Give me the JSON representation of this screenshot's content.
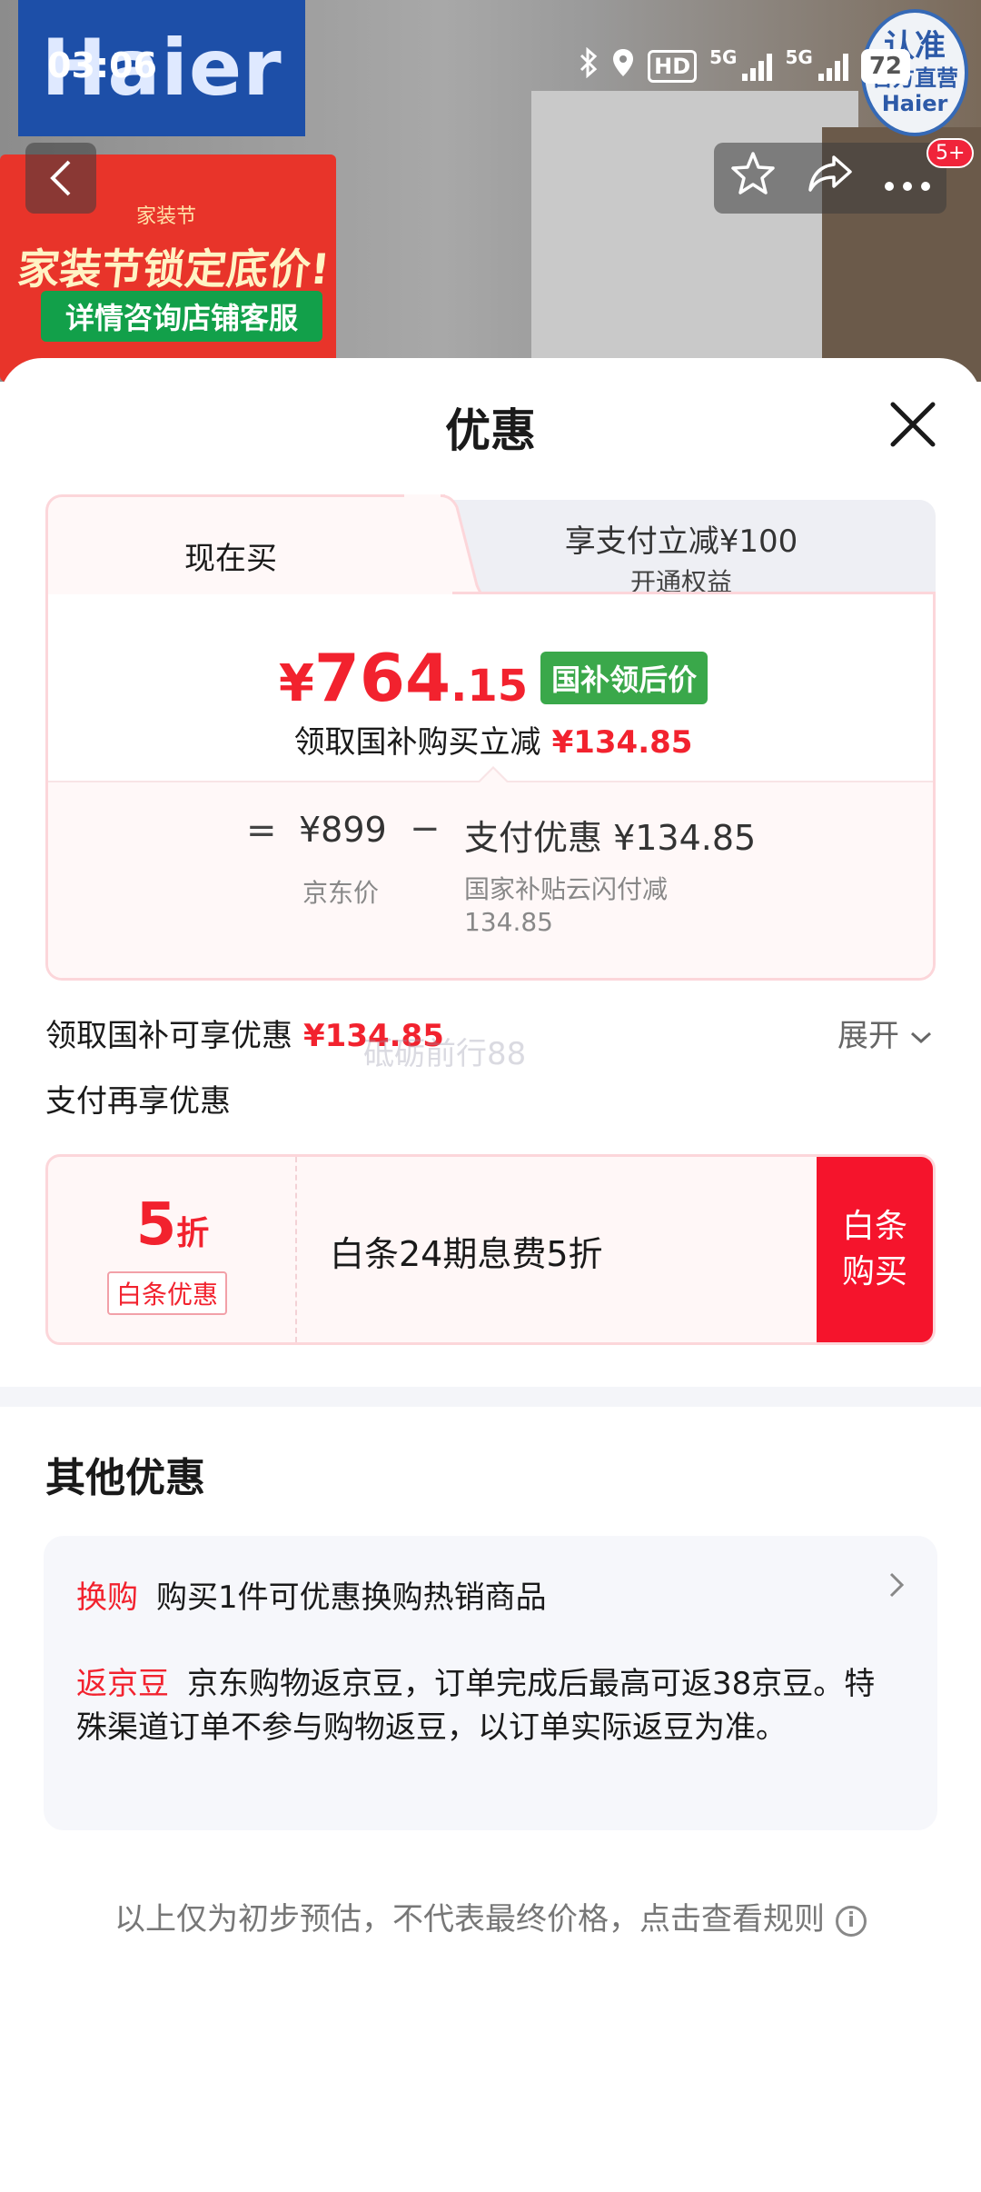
{
  "status_bar": {
    "time": "03:06",
    "hd_label": "HD",
    "net1": "5G",
    "net2": "5G",
    "battery": "72"
  },
  "background": {
    "brand_logo": "Haier",
    "badge_line1": "认准",
    "badge_line2": "官方直营",
    "badge_line3": "Haier",
    "promo_top": "家装节",
    "promo_main": "家装节锁定底价!",
    "promo_sub": "详情咨询店铺客服"
  },
  "nav": {
    "cart_badge": "5+"
  },
  "sheet": {
    "title": "优惠"
  },
  "tabs": {
    "active_label": "现在买",
    "inactive_line1": "享支付立减¥100",
    "inactive_line2": "开通权益"
  },
  "price": {
    "yen": "¥",
    "integer": "764",
    "decimal": ".15",
    "tag": "国补领后价",
    "subsidy_text": "领取国补购买立减",
    "subsidy_amount": "¥134.85"
  },
  "calc": {
    "equals": "=",
    "jd_price": "¥899",
    "jd_label": "京东价",
    "minus": "−",
    "pay_discount": "支付优惠 ¥134.85",
    "pay_desc_line1": "国家补贴云闪付减",
    "pay_desc_line2": "134.85"
  },
  "gov_row": {
    "label": "领取国补可享优惠",
    "amount": "¥134.85",
    "expand": "展开"
  },
  "watermark": "砥砺前行88",
  "pay_row": {
    "label": "支付再享优惠"
  },
  "baitiao": {
    "big_number": "5",
    "big_unit": "折",
    "tag": "白条优惠",
    "desc": "白条24期息费5折",
    "button_line1": "白条",
    "button_line2": "购买"
  },
  "other": {
    "title": "其他优惠",
    "row1_tag": "换购",
    "row1_text": "购买1件可优惠换购热销商品",
    "row2_tag": "返京豆",
    "row2_text": "京东购物返京豆，订单完成后最高可返38京豆。特殊渠道订单不参与购物返豆，以订单实际返豆为准。"
  },
  "footer": {
    "note": "以上仅为初步预估，不代表最终价格，点击查看规则",
    "info_icon": "i"
  },
  "colors": {
    "accent_red": "#f2222e",
    "button_red": "#f5142c",
    "tag_green": "#3aa84a",
    "card_border": "#fcd6da"
  }
}
